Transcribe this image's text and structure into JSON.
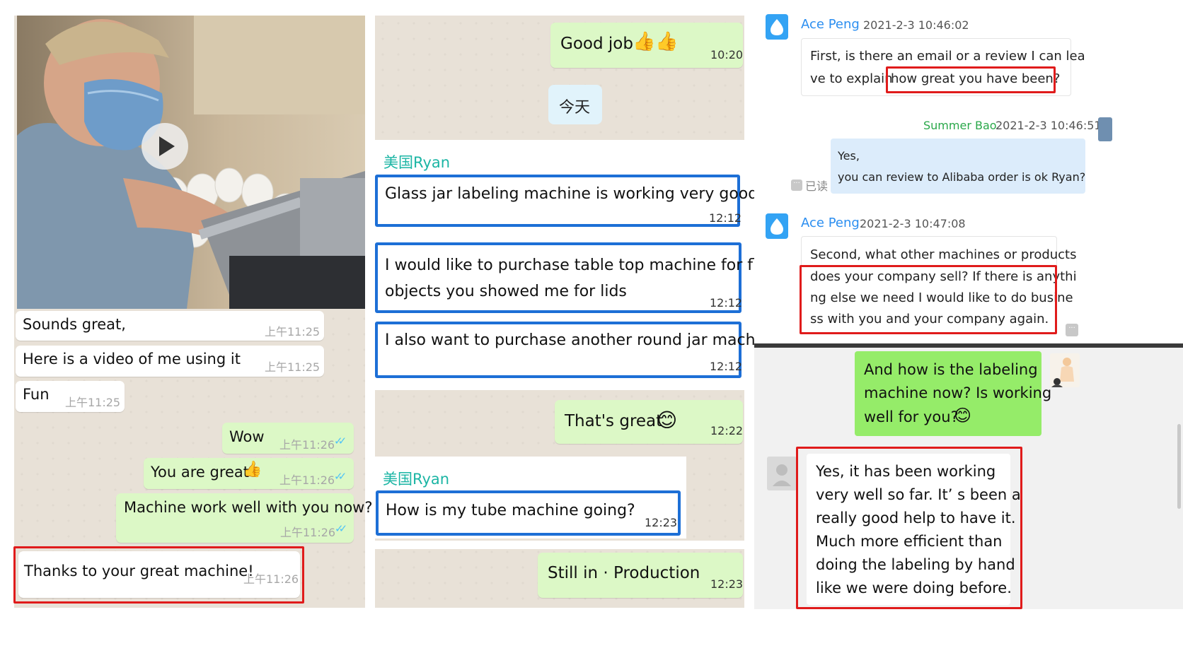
{
  "panel1": {
    "messages": [
      {
        "text": "Sounds great,",
        "time": "上午11:25"
      },
      {
        "text": "Here is a video of me using it",
        "time": "上午11:25"
      },
      {
        "text": "Fun",
        "time": "上午11:25"
      },
      {
        "text": "Wow",
        "time": "上午11:26"
      },
      {
        "text": "You are great",
        "time": "上午11:26"
      },
      {
        "text": "Machine work well with you now?",
        "time": "上午11:26"
      },
      {
        "text": "Thanks to your great machine!",
        "time": "上午11:26"
      }
    ],
    "play_icon": "play-icon",
    "thumbs_icon": "thumbs-up-emoji"
  },
  "panel2": {
    "good_job": {
      "text": "Good job",
      "time": "10:20"
    },
    "date_chip": "今天",
    "sender1": "美国Ryan",
    "sender2": "美国Ryan",
    "messages": [
      {
        "text": "Glass jar labeling machine is working very good.",
        "time": "12:12"
      },
      {
        "line1": "I would like to purchase table top machine for flat",
        "line2": "objects you showed me for lids",
        "time": "12:12"
      },
      {
        "text": "I also want to purchase another round jar machine",
        "time": "12:12"
      }
    ],
    "thats_great": {
      "text": "That's great",
      "time": "12:22"
    },
    "tube": {
      "text": "How is my tube machine going?",
      "time": "12:23"
    },
    "production": {
      "text": "Still in · Production",
      "time": "12:23"
    }
  },
  "panel3": {
    "msg1": {
      "name": "Ace Peng",
      "time": "2021-2-3 10:46:02",
      "line1": "First, is there an email or a review I can lea",
      "line2a": "ve to explain",
      "line2b": "how great you have been?"
    },
    "msg2": {
      "name": "Summer Bao",
      "time": "2021-2-3 10:46:51",
      "line1": "Yes,",
      "line2": "you can review to Alibaba order is ok Ryan?",
      "read": "已读"
    },
    "msg3": {
      "name": "Ace Peng",
      "time": "2021-2-3 10:47:08",
      "line1": "Second, what other machines or products",
      "line2": "does your company sell? If there is anythi",
      "line3": "ng else we need I would like to do busine",
      "line4": "ss with you and your company again."
    }
  },
  "panel4": {
    "out": {
      "line1": "And how is the labeling",
      "line2": "machine now?  Is working",
      "line3": "well for you?"
    },
    "in": {
      "lines": [
        "Yes, it has been working",
        "very well so far. It’  s been a",
        "really good help to have it.",
        "Much more efficient than",
        "doing the labeling by hand",
        "like we were doing before."
      ]
    }
  },
  "colors": {
    "highlight_red": "#e01b1b",
    "highlight_blue": "#1d6fd6",
    "wa_out": "#dcf8c6",
    "wechat_green": "#95ec69",
    "link_blue": "#2b8ef0"
  }
}
